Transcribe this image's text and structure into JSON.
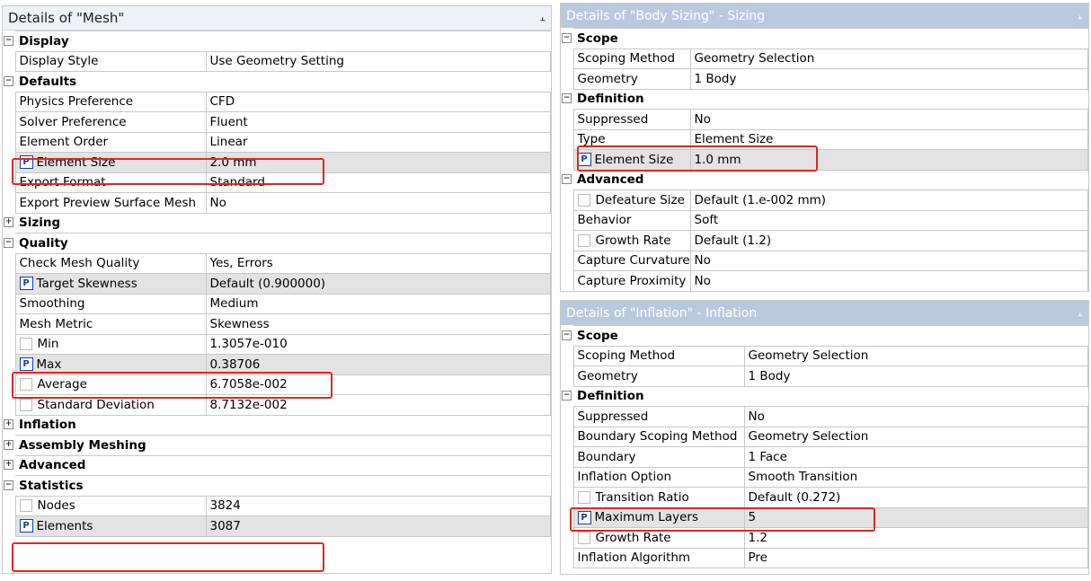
{
  "mesh": {
    "title": "Details of \"Mesh\"",
    "rows": [
      {
        "type": "section",
        "label": "Display",
        "expander": "−"
      },
      {
        "type": "row",
        "key": "Display Style",
        "value": "Use Geometry Setting"
      },
      {
        "type": "section",
        "label": "Defaults",
        "expander": "−"
      },
      {
        "type": "row",
        "key": "Physics Preference",
        "value": "CFD"
      },
      {
        "type": "row",
        "key": "Solver Preference",
        "value": "Fluent"
      },
      {
        "type": "row",
        "key": "Element Order",
        "value": "Linear"
      },
      {
        "type": "row",
        "key": "Element Size",
        "value": "2.0 mm",
        "param": true
      },
      {
        "type": "row",
        "key": "Export Format",
        "value": "Standard"
      },
      {
        "type": "row",
        "key": "Export Preview Surface Mesh",
        "value": "No"
      },
      {
        "type": "section",
        "label": "Sizing",
        "expander": "+"
      },
      {
        "type": "section",
        "label": "Quality",
        "expander": "−"
      },
      {
        "type": "row",
        "key": "Check Mesh Quality",
        "value": "Yes, Errors"
      },
      {
        "type": "row",
        "key": "Target Skewness",
        "value": "Default (0.900000)",
        "param": true
      },
      {
        "type": "row",
        "key": "Smoothing",
        "value": "Medium"
      },
      {
        "type": "row",
        "key": "Mesh Metric",
        "value": "Skewness"
      },
      {
        "type": "row",
        "key": "Min",
        "value": "1.3057e-010",
        "check": true
      },
      {
        "type": "row",
        "key": "Max",
        "value": "0.38706",
        "param": true
      },
      {
        "type": "row",
        "key": "Average",
        "value": "6.7058e-002",
        "check": true
      },
      {
        "type": "row",
        "key": "Standard Deviation",
        "value": "8.7132e-002",
        "check": true
      },
      {
        "type": "section",
        "label": "Inflation",
        "expander": "+"
      },
      {
        "type": "section",
        "label": "Assembly Meshing",
        "expander": "+"
      },
      {
        "type": "section",
        "label": "Advanced",
        "expander": "+"
      },
      {
        "type": "section",
        "label": "Statistics",
        "expander": "−"
      },
      {
        "type": "row",
        "key": "Nodes",
        "value": "3824",
        "check": true
      },
      {
        "type": "row",
        "key": "Elements",
        "value": "3087",
        "param": true
      }
    ]
  },
  "body_sizing": {
    "title": "Details of \"Body Sizing\" - Sizing",
    "rows": [
      {
        "type": "section",
        "label": "Scope",
        "expander": "−"
      },
      {
        "type": "row",
        "key": "Scoping Method",
        "value": "Geometry Selection"
      },
      {
        "type": "row",
        "key": "Geometry",
        "value": "1 Body"
      },
      {
        "type": "section",
        "label": "Definition",
        "expander": "−"
      },
      {
        "type": "row",
        "key": "Suppressed",
        "value": "No"
      },
      {
        "type": "row",
        "key": "Type",
        "value": "Element Size"
      },
      {
        "type": "row",
        "key": "Element Size",
        "value": "1.0 mm",
        "param": true
      },
      {
        "type": "section",
        "label": "Advanced",
        "expander": "−"
      },
      {
        "type": "row",
        "key": "Defeature Size",
        "value": "Default (1.e-002 mm)",
        "check": true
      },
      {
        "type": "row",
        "key": "Behavior",
        "value": "Soft"
      },
      {
        "type": "row",
        "key": "Growth Rate",
        "value": "Default (1.2)",
        "check": true
      },
      {
        "type": "row",
        "key": "Capture Curvature",
        "value": "No"
      },
      {
        "type": "row",
        "key": "Capture Proximity",
        "value": "No"
      }
    ]
  },
  "inflation": {
    "title": "Details of \"Inflation\" - Inflation",
    "rows": [
      {
        "type": "section",
        "label": "Scope",
        "expander": "−"
      },
      {
        "type": "row",
        "key": "Scoping Method",
        "value": "Geometry Selection"
      },
      {
        "type": "row",
        "key": "Geometry",
        "value": "1 Body"
      },
      {
        "type": "section",
        "label": "Definition",
        "expander": "−"
      },
      {
        "type": "row",
        "key": "Suppressed",
        "value": "No"
      },
      {
        "type": "row",
        "key": "Boundary Scoping Method",
        "value": "Geometry Selection"
      },
      {
        "type": "row",
        "key": "Boundary",
        "value": "1 Face"
      },
      {
        "type": "row",
        "key": "Inflation Option",
        "value": "Smooth Transition"
      },
      {
        "type": "row",
        "key": "Transition Ratio",
        "value": "Default (0.272)",
        "check": true
      },
      {
        "type": "row",
        "key": "Maximum Layers",
        "value": "5",
        "param": true
      },
      {
        "type": "row",
        "key": "Growth Rate",
        "value": "1.2",
        "check": true
      },
      {
        "type": "row",
        "key": "Inflation Algorithm",
        "value": "Pre"
      }
    ]
  },
  "ui": {
    "pin_glyph": "ᵩ",
    "param_badge": "P",
    "highlight_color": "#e5251f",
    "header_blue": "#b9cadf"
  }
}
